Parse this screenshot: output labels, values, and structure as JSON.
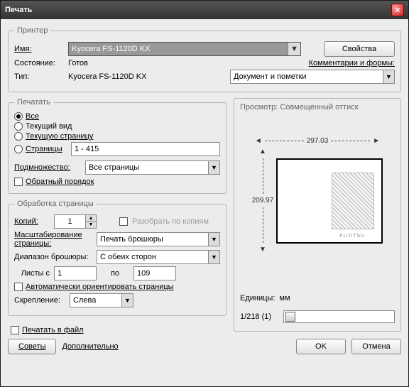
{
  "window": {
    "title": "Печать"
  },
  "printer": {
    "legend": "Принтер",
    "name_label": "Имя:",
    "name_value": "Kyocera FS-1120D KX",
    "properties_btn": "Свойства",
    "status_label": "Состояние:",
    "status_value": "Готов",
    "type_label": "Тип:",
    "type_value": "Kyocera FS-1120D KX",
    "comments_label": "Комментарии и формы:",
    "comments_value": "Документ и пометки"
  },
  "range": {
    "legend": "Печатать",
    "all": "Все",
    "current_view": "Текущий вид",
    "current_page": "Текущую страницу",
    "pages": "Страницы",
    "pages_value": "1 - 415",
    "subset_label": "Подмножество:",
    "subset_value": "Все страницы",
    "reverse": "Обратный порядок"
  },
  "handling": {
    "legend": "Обработка страницы",
    "copies_label": "Копий:",
    "copies_value": "1",
    "collate": "Разобрать по копиям",
    "scaling_label": "Масштабирование страницы:",
    "scaling_value": "Печать брошюры",
    "booklet_range_label": "Диапазон брошюры:",
    "booklet_range_value": "С обеих сторон",
    "sheets_from": "Листы с",
    "sheets_from_value": "1",
    "sheets_to": "по",
    "sheets_to_value": "109",
    "auto_rotate": "Автоматически ориентировать страницы",
    "binding_label": "Скрепление:",
    "binding_value": "Слева"
  },
  "print_to_file": "Печатать в файл",
  "preview": {
    "title": "Просмотр: Совмещенный оттиск",
    "width": "297.03",
    "height": "209.97",
    "brand": "FUJITSU",
    "units_label": "Единицы:",
    "units_value": "мм",
    "page_indicator": "1/218 (1)"
  },
  "buttons": {
    "tips": "Советы",
    "advanced": "Дополнительно",
    "ok": "OK",
    "cancel": "Отмена"
  }
}
